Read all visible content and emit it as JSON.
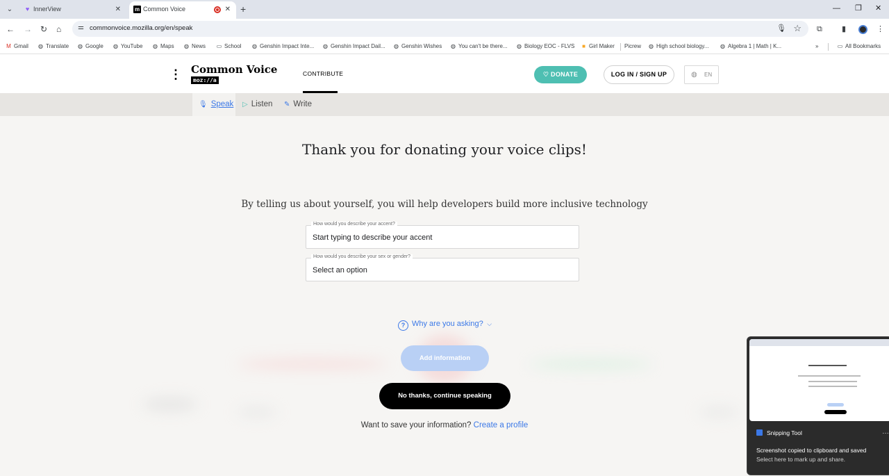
{
  "browser": {
    "tabs": [
      {
        "title": "InnerView",
        "active": false
      },
      {
        "title": "Common Voice",
        "active": true
      }
    ],
    "url": "commonvoice.mozilla.org/en/speak",
    "bookmarks": [
      "Gmail",
      "Translate",
      "Google",
      "YouTube",
      "Maps",
      "News",
      "School",
      "Genshin Impact Inte...",
      "Genshin Impact Dail...",
      "Genshin Wishes",
      "You can't be there...",
      "Biology EOC - FLVS",
      "Girl Maker",
      "Picrew",
      "High school biology...",
      "Algebra 1 | Math | K..."
    ],
    "all_bookmarks": "All Bookmarks"
  },
  "site": {
    "logo_text": "Common Voice",
    "logo_sub": "moz://a",
    "nav_contribute": "CONTRIBUTE",
    "donate": "DONATE",
    "login": "LOG IN / SIGN UP",
    "lang": "EN",
    "subnav": [
      "Speak",
      "Listen",
      "Write"
    ]
  },
  "main": {
    "thanks": "Thank you for donating your voice clips!",
    "subheading": "By telling us about yourself, you will help developers build more inclusive technology",
    "accent_label": "How would you describe your accent?",
    "accent_placeholder": "Start typing to describe your accent",
    "gender_label": "How would you describe your sex or gender?",
    "gender_value": "Select an option",
    "why_asking": "Why are you asking?",
    "add_info": "Add information",
    "no_thanks": "No thanks, continue speaking",
    "save_prompt": "Want to save your information?",
    "create_profile": "Create a profile"
  },
  "toast": {
    "app": "Snipping Tool",
    "message": "Screenshot copied to clipboard and saved",
    "sub": "Select here to mark up and share."
  },
  "colors": {
    "accent_blue": "#3b78e7",
    "donate_teal": "#4ebfb2",
    "add_info_bg": "#b9d0f5",
    "page_bg": "#f6f5f3"
  }
}
